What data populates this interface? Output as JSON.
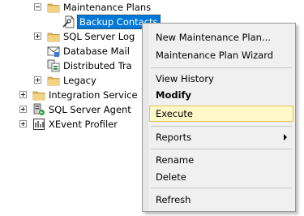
{
  "tree": {
    "items": [
      {
        "label": "Maintenance Plans"
      },
      {
        "label": "Backup Contacts"
      },
      {
        "label": "SQL Server Log"
      },
      {
        "label": "Database Mail"
      },
      {
        "label": "Distributed Tra"
      },
      {
        "label": "Legacy"
      },
      {
        "label": "Integration Service"
      },
      {
        "label": "SQL Server Agent"
      },
      {
        "label": "XEvent Profiler"
      }
    ]
  },
  "context_menu": {
    "items": [
      {
        "label": "New Maintenance Plan..."
      },
      {
        "label": "Maintenance Plan Wizard"
      },
      {
        "label": "View History"
      },
      {
        "label": "Modify"
      },
      {
        "label": "Execute"
      },
      {
        "label": "Reports"
      },
      {
        "label": "Rename"
      },
      {
        "label": "Delete"
      },
      {
        "label": "Refresh"
      }
    ],
    "hovered": "Execute"
  },
  "colors": {
    "selection": "#0078d7",
    "menu_bg": "#f0f0f0",
    "hover_bg": "#fff8c8",
    "hover_border": "#e4c350",
    "folder": "#dcb35c"
  }
}
